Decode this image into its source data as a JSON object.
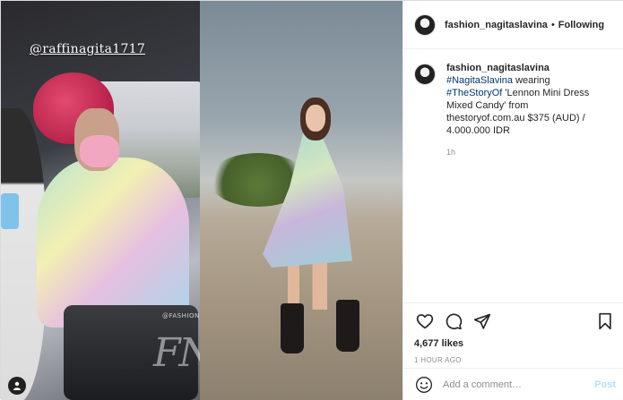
{
  "media": {
    "story_tag": "@raffinagita1717",
    "watermark_small": "@FASHION_NAGITASLAVINA",
    "watermark_big": "FNS"
  },
  "header": {
    "username": "fashion_nagitaslavina",
    "separator": "•",
    "follow_label": "Following"
  },
  "caption": {
    "username": "fashion_nagitaslavina",
    "hashtag_1": "#NagitaSlavina",
    "text_1": "wearing",
    "hashtag_2": "#TheStoryOf",
    "text_2": "'Lennon Mini Dress Mixed Candy' from thestoryof.com.au $375 (AUD) / 4.000.000 IDR",
    "time": "1h"
  },
  "actions": {
    "likes": "4,677 likes",
    "post_time": "1 HOUR AGO"
  },
  "comment_box": {
    "placeholder": "Add a comment…",
    "post_label": "Post"
  },
  "icons": [
    "like-icon",
    "comment-icon",
    "share-icon",
    "save-icon",
    "emoji-icon",
    "user-tag-icon"
  ],
  "colors": {
    "hashtag": "#00376b",
    "post_disabled": "#b2dffc",
    "muted": "#8e8e8e"
  }
}
